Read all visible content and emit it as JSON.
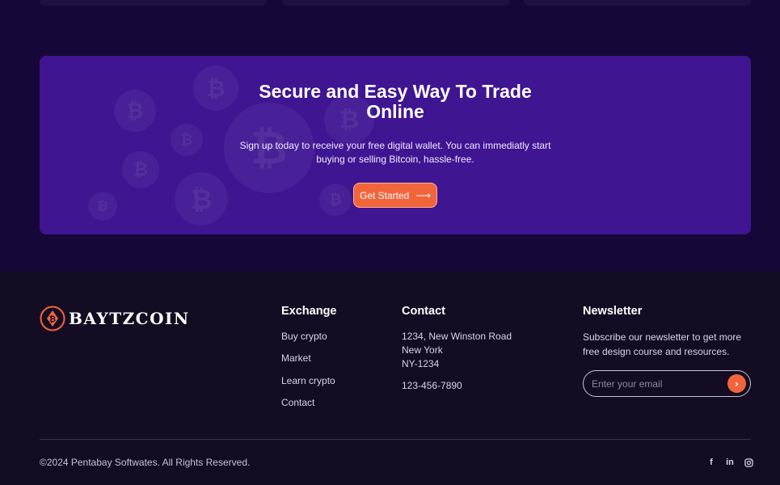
{
  "cta": {
    "title": "Secure and Easy Way To Trade Online",
    "text": "Sign up today to receive your free digital wallet. You can immediatly start buying or selling Bitcoin, hassle-free.",
    "button_label": "Get Started",
    "button_color": "#f2653b",
    "background_color": "#3f1592"
  },
  "brand": {
    "name": "BAYTZCOIN",
    "logo_icon": "bitcoin-logo-icon"
  },
  "exchange": {
    "title": "Exchange",
    "links": [
      "Buy crypto",
      "Market",
      "Learn crypto",
      "Contact"
    ]
  },
  "contact": {
    "title": "Contact",
    "address": [
      "1234, New Winston Road",
      "New York",
      "NY-1234"
    ],
    "phone": "123-456-7890"
  },
  "newsletter": {
    "title": "Newsletter",
    "text": "Subscribe our newsletter to get more free design course and resources.",
    "placeholder": "Enter your email",
    "submit_icon": "chevron-right-icon"
  },
  "footer": {
    "copyright": "©2024 Pentabay Softwates. All Rights Reserved.",
    "social_icons": [
      "facebook-icon",
      "linkedin-icon",
      "instagram-icon"
    ]
  }
}
